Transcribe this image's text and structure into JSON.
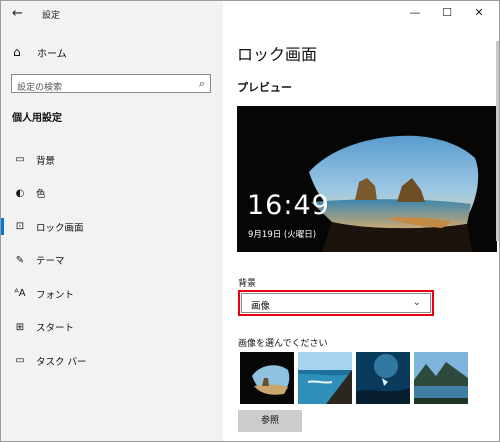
{
  "window": {
    "app_title": "設定",
    "back_glyph": "←",
    "controls": {
      "minimize": "—",
      "maximize": "☐",
      "close": "✕"
    }
  },
  "sidebar": {
    "home_label": "ホーム",
    "search_placeholder": "設定の検索",
    "section_title": "個人用設定",
    "items": [
      {
        "label": "背景",
        "icon": "picture-icon",
        "glyph": "▭"
      },
      {
        "label": "色",
        "icon": "palette-icon",
        "glyph": "◐"
      },
      {
        "label": "ロック画面",
        "icon": "lock-screen-icon",
        "glyph": "⊡",
        "active": true
      },
      {
        "label": "テーマ",
        "icon": "theme-icon",
        "glyph": "✎"
      },
      {
        "label": "フォント",
        "icon": "font-icon",
        "glyph": "ᴬA"
      },
      {
        "label": "スタート",
        "icon": "start-icon",
        "glyph": "⊞"
      },
      {
        "label": "タスク バー",
        "icon": "taskbar-icon",
        "glyph": "▭"
      }
    ],
    "accent_color": "#0078d7"
  },
  "main": {
    "title": "ロック画面",
    "preview_label": "プレビュー",
    "preview_time": "16:49",
    "preview_date": "9月19日 (火曜日)",
    "background_label": "背景",
    "background_value": "画像",
    "choose_label": "画像を選んでください",
    "browse_button": "参照",
    "highlight_color": "#e60012"
  }
}
